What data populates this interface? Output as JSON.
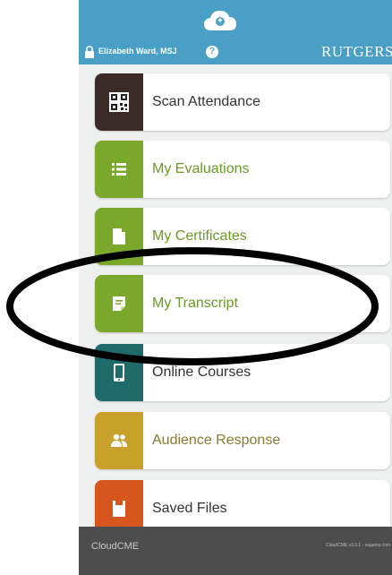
{
  "header": {
    "user_name": "Elizabeth Ward, MSJ",
    "help_glyph": "?",
    "brand": "RUTGERS",
    "color": "#4a9fc6",
    "icons": [
      "cloud-icon",
      "lock-icon",
      "help-icon"
    ]
  },
  "menu": [
    {
      "label": "Scan Attendance",
      "icon": "qr-code-icon",
      "tile_color": "#3a2b26",
      "label_color": "#333333"
    },
    {
      "label": "My Evaluations",
      "icon": "list-icon",
      "tile_color": "#7aa82a",
      "label_color": "#6a9a22"
    },
    {
      "label": "My Certificates",
      "icon": "certificate-icon",
      "tile_color": "#7aa82a",
      "label_color": "#6a9a22"
    },
    {
      "label": "My Transcript",
      "icon": "transcript-icon",
      "tile_color": "#7aa82a",
      "label_color": "#6a9a22"
    },
    {
      "label": "Online Courses",
      "icon": "tablet-icon",
      "tile_color": "#1f6b6b",
      "label_color": "#333333"
    },
    {
      "label": "Audience Response",
      "icon": "people-icon",
      "tile_color": "#c8a12a",
      "label_color": "#8a7a30"
    },
    {
      "label": "Saved Files",
      "icon": "file-icon",
      "tile_color": "#d6561e",
      "label_color": "#333333"
    }
  ],
  "footer": {
    "logo": "CloudCME",
    "version": "CloudCME v3.0.1 - sagems.com"
  },
  "annotation": {
    "shape": "ellipse",
    "color": "#000000",
    "target": "My Transcript"
  }
}
